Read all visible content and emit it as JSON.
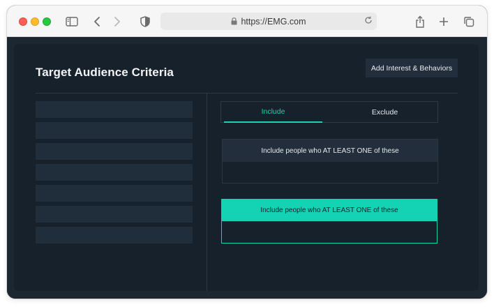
{
  "browser": {
    "url": "https://EMG.com"
  },
  "page": {
    "title": "Target Audience Criteria",
    "add_button_label": "Add Interest & Behaviors"
  },
  "sidebar": {
    "placeholder_bars": 7
  },
  "tabs": [
    {
      "label": "Include",
      "active": true
    },
    {
      "label": "Exclude",
      "active": false
    }
  ],
  "criteria_boxes": [
    {
      "header": "Include people who AT LEAST ONE of these"
    },
    {
      "header": "Include people who AT LEAST ONE of these"
    }
  ],
  "colors": {
    "accent": "#14d3b4",
    "background": "#17212b",
    "surface": "#222e3b"
  }
}
